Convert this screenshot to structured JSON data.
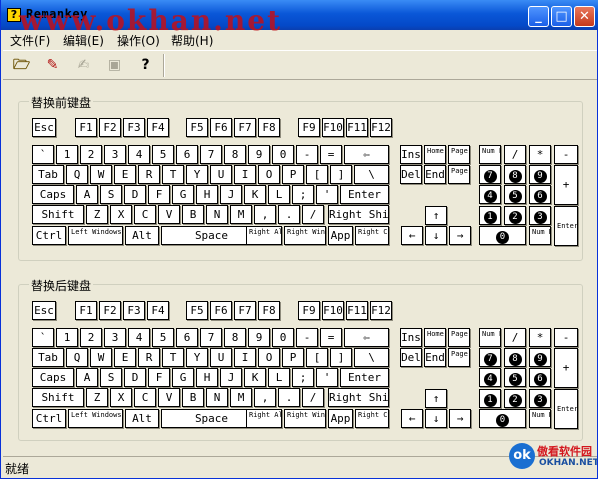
{
  "window": {
    "title": "Remankey",
    "watermark": "www.okhan.net",
    "app_icon": "?"
  },
  "menu": [
    "文件(F)",
    "编辑(E)",
    "操作(O)",
    "帮助(H)"
  ],
  "toolbar": {
    "help_glyph": "?"
  },
  "groups": {
    "before": "替换前键盘",
    "after": "替换后键盘"
  },
  "status": "就绪",
  "logo": {
    "cn": "傲看软件园",
    "en": "OKHAN.NET",
    "mark": "ok"
  },
  "keyboard": {
    "fn": [
      "Esc",
      "F1",
      "F2",
      "F3",
      "F4",
      "F5",
      "F6",
      "F7",
      "F8",
      "F9",
      "F10",
      "F11",
      "F12"
    ],
    "row1": [
      "`",
      "1",
      "2",
      "3",
      "4",
      "5",
      "6",
      "7",
      "8",
      "9",
      "0",
      "-",
      "=",
      "⇦"
    ],
    "row2": [
      "Tab",
      "Q",
      "W",
      "E",
      "R",
      "T",
      "Y",
      "U",
      "I",
      "O",
      "P",
      "[",
      "]",
      "\\"
    ],
    "row3": [
      "Caps",
      "A",
      "S",
      "D",
      "F",
      "G",
      "H",
      "J",
      "K",
      "L",
      ";",
      "'",
      "Enter"
    ],
    "row4": [
      "Shift",
      "Z",
      "X",
      "C",
      "V",
      "B",
      "N",
      "M",
      ",",
      ".",
      "/",
      "Right Shift"
    ],
    "row5": [
      "Ctrl",
      "Left Windows",
      "Alt",
      "Space",
      "Right Alt",
      "Right Windows",
      "App",
      "Right Ctrl"
    ],
    "nav": [
      "Ins",
      "Home",
      "Page Up",
      "Del",
      "End",
      "Page Down"
    ],
    "arrows": [
      "↑",
      "←",
      "↓",
      "→"
    ],
    "numpad": [
      "Num Lock",
      "/",
      "*",
      "-",
      "7",
      "8",
      "9",
      "+",
      "4",
      "5",
      "6",
      "1",
      "2",
      "3",
      "Enter",
      "0",
      "Num Del"
    ]
  }
}
